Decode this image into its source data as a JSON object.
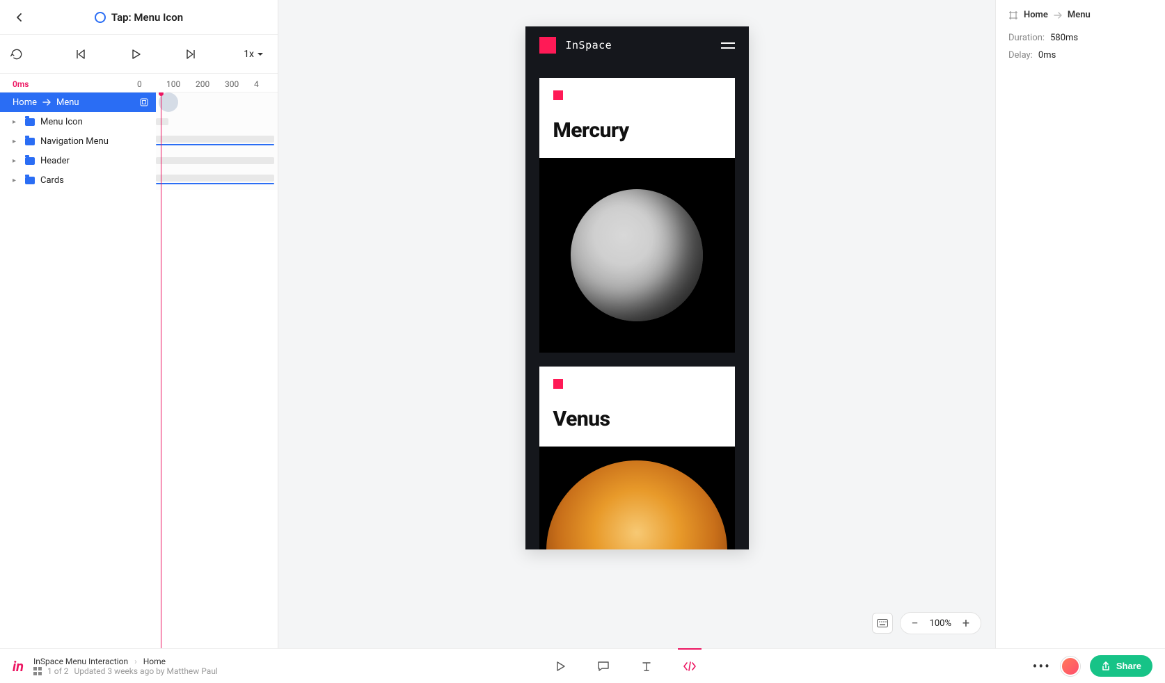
{
  "header": {
    "title": "Tap: Menu Icon"
  },
  "transport": {
    "speed": "1x"
  },
  "timeline": {
    "current_ms": "0ms",
    "ticks": [
      "0",
      "100",
      "200",
      "300",
      "4"
    ],
    "transition": {
      "from": "Home",
      "to": "Menu"
    },
    "layers": [
      {
        "name": "Menu Icon"
      },
      {
        "name": "Navigation Menu"
      },
      {
        "name": "Header"
      },
      {
        "name": "Cards"
      }
    ]
  },
  "canvas": {
    "brand": "InSpace",
    "cards": [
      {
        "title": "Mercury"
      },
      {
        "title": "Venus"
      }
    ],
    "zoom": "100%"
  },
  "inspector": {
    "breadcrumb_from": "Home",
    "breadcrumb_to": "Menu",
    "duration_label": "Duration:",
    "duration_value": "580ms",
    "delay_label": "Delay:",
    "delay_value": "0ms"
  },
  "footer": {
    "project": "InSpace Menu Interaction",
    "screen": "Home",
    "page_info": "1 of 2",
    "updated": "Updated 3 weeks ago by Matthew Paul",
    "share": "Share"
  }
}
